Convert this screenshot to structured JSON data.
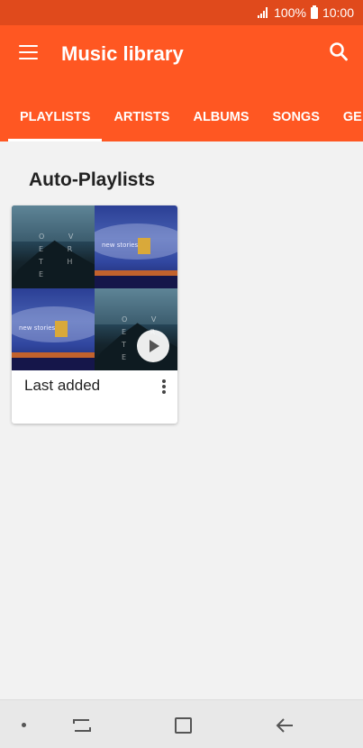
{
  "status_bar": {
    "battery": "100%",
    "time": "10:00"
  },
  "app_bar": {
    "title": "Music library",
    "tabs": [
      {
        "label": "PLAYLISTS",
        "active": true
      },
      {
        "label": "ARTISTS",
        "active": false
      },
      {
        "label": "ALBUMS",
        "active": false
      },
      {
        "label": "SONGS",
        "active": false
      },
      {
        "label": "GE",
        "active": false
      }
    ]
  },
  "section": {
    "title": "Auto-Playlists",
    "playlists": [
      {
        "label": "Last added",
        "album_art_text": {
          "over_the": "O V E R T H E",
          "new_stories": "new stories"
        }
      }
    ]
  },
  "icons": [
    "menu-icon",
    "search-icon",
    "play-icon",
    "more-vert-icon",
    "nav-dot-icon",
    "recent-apps-icon",
    "home-icon",
    "back-icon"
  ],
  "colors": {
    "accent": "#ff5722",
    "status_bar": "#e04a1c"
  }
}
